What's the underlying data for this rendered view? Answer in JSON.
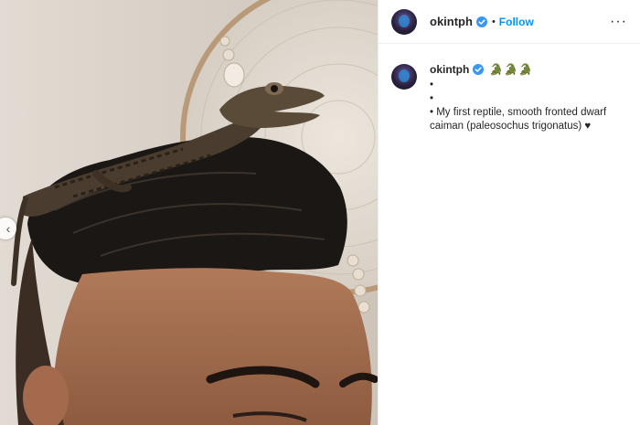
{
  "post": {
    "username": "okintph",
    "separator": "•",
    "follow_label": "Follow",
    "more_label": "···"
  },
  "carousel": {
    "prev_label": "‹"
  },
  "caption": {
    "username": "okintph",
    "emoji": "🐊🐊🐊",
    "lines": [
      "•",
      "•",
      "• My first reptile, smooth fronted dwarf caiman (paleosochus trigonatus) ♥"
    ]
  },
  "colors": {
    "follow": "#0095f6",
    "text": "#262626",
    "divider": "#efefef",
    "verified": "#3897f0"
  },
  "icons": {
    "verified": "verified-badge-icon",
    "more": "more-options-icon",
    "carousel_prev": "chevron-left-icon"
  }
}
